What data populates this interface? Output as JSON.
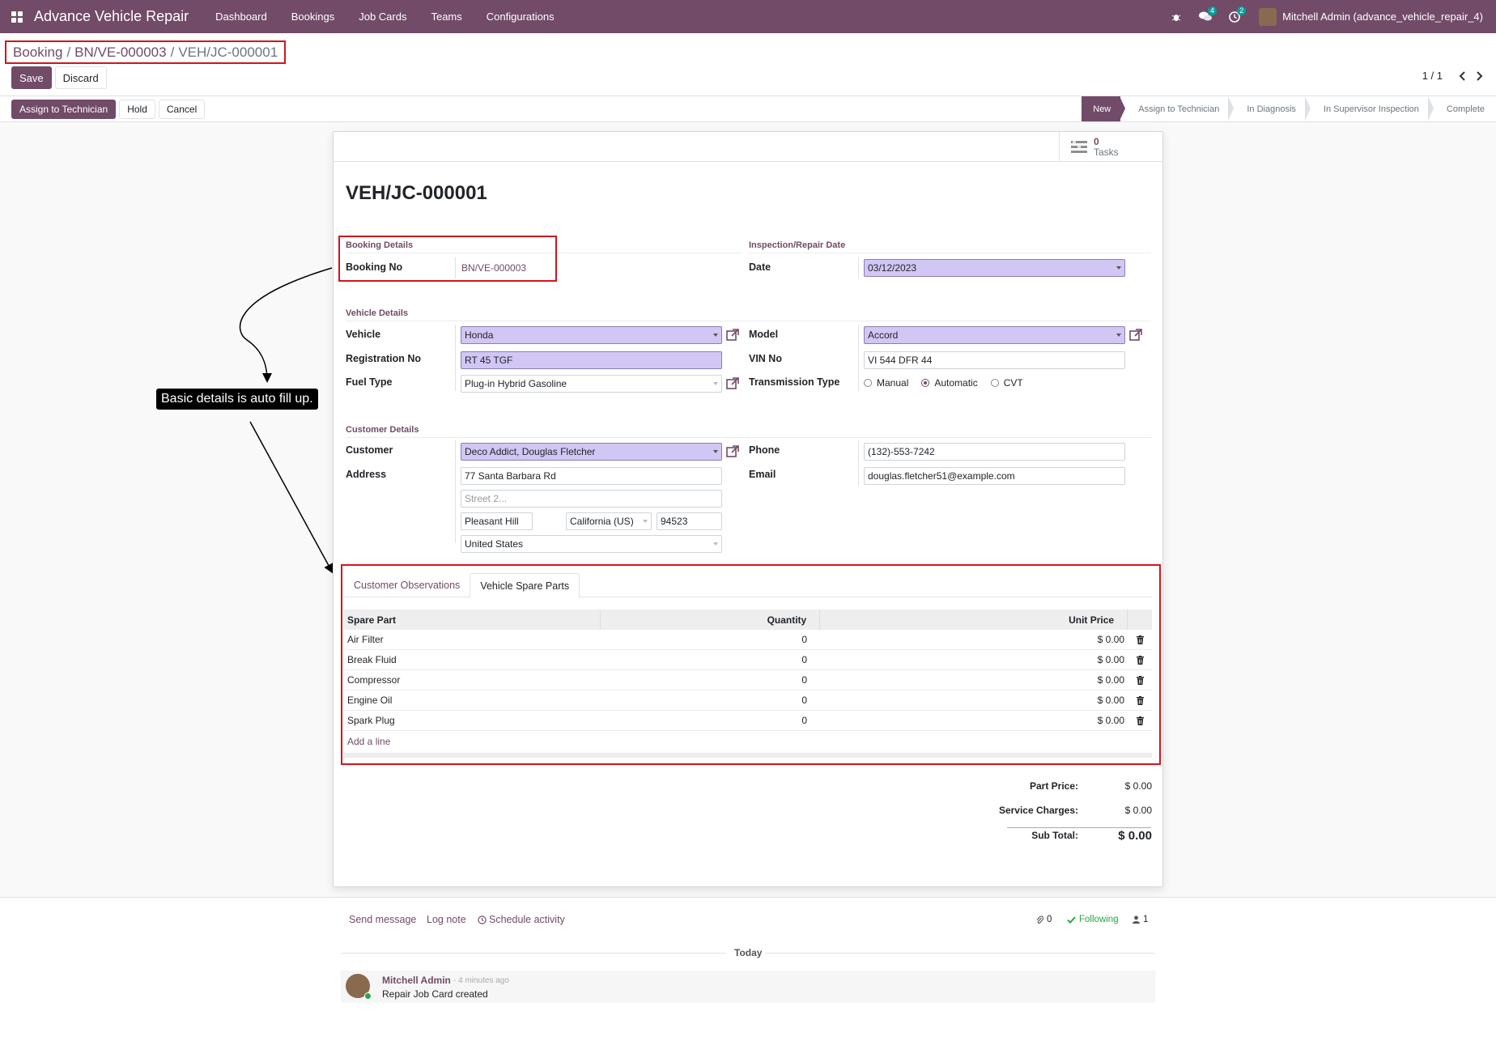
{
  "app": {
    "title": "Advance Vehicle Repair",
    "menu": [
      "Dashboard",
      "Bookings",
      "Job Cards",
      "Teams",
      "Configurations"
    ],
    "messages_badge": "4",
    "activities_badge": "2",
    "user": "Mitchell Admin (advance_vehicle_repair_4)"
  },
  "breadcrumb": {
    "root": "Booking",
    "sep1": "/",
    "parent": "BN/VE-000003",
    "sep2": "/",
    "current": "VEH/JC-000001"
  },
  "actions": {
    "save": "Save",
    "discard": "Discard"
  },
  "pager": {
    "value": "1 / 1"
  },
  "status_buttons": {
    "assign": "Assign to Technician",
    "hold": "Hold",
    "cancel": "Cancel"
  },
  "stages": [
    "New",
    "Assign to Technician",
    "In Diagnosis",
    "In Supervisor Inspection",
    "Complete"
  ],
  "smart_button": {
    "count": "0",
    "label": "Tasks"
  },
  "form": {
    "title": "VEH/JC-000001",
    "booking_section": "Booking Details",
    "booking_no_label": "Booking No",
    "booking_no": "BN/VE-000003",
    "inspection_section": "Inspection/Repair Date",
    "date_label": "Date",
    "date": "03/12/2023",
    "vehicle_section": "Vehicle Details",
    "vehicle_label": "Vehicle",
    "vehicle": "Honda",
    "model_label": "Model",
    "model": "Accord",
    "reg_label": "Registration No",
    "reg": "RT 45 TGF",
    "vin_label": "VIN No",
    "vin": "VI 544 DFR 44",
    "fuel_label": "Fuel Type",
    "fuel": "Plug-in Hybrid Gasoline",
    "transmission_label": "Transmission Type",
    "transmission_options": [
      "Manual",
      "Automatic",
      "CVT"
    ],
    "customer_section": "Customer Details",
    "customer_label": "Customer",
    "customer": "Deco Addict, Douglas Fletcher",
    "phone_label": "Phone",
    "phone": "(132)-553-7242",
    "address_label": "Address",
    "street": "77 Santa Barbara Rd",
    "street2_placeholder": "Street 2...",
    "city": "Pleasant Hill",
    "state": "California (US)",
    "zip": "94523",
    "country": "United States",
    "email_label": "Email",
    "email": "douglas.fletcher51@example.com"
  },
  "tabs": [
    "Customer Observations",
    "Vehicle Spare Parts"
  ],
  "grid": {
    "headers": [
      "Spare Part",
      "Quantity",
      "Unit Price"
    ],
    "rows": [
      {
        "part": "Air Filter",
        "qty": "0",
        "price": "$ 0.00"
      },
      {
        "part": "Break Fluid",
        "qty": "0",
        "price": "$ 0.00"
      },
      {
        "part": "Compressor",
        "qty": "0",
        "price": "$ 0.00"
      },
      {
        "part": "Engine Oil",
        "qty": "0",
        "price": "$ 0.00"
      },
      {
        "part": "Spark Plug",
        "qty": "0",
        "price": "$ 0.00"
      }
    ],
    "add_line": "Add a line"
  },
  "totals": {
    "part_price_label": "Part Price:",
    "part_price": "$ 0.00",
    "service_label": "Service Charges:",
    "service": "$ 0.00",
    "subtotal_label": "Sub Total:",
    "subtotal": "$ 0.00"
  },
  "annotation": "Basic details is auto fill up.",
  "chatter": {
    "send_message": "Send message",
    "log_note": "Log note",
    "schedule_activity": "Schedule activity",
    "attachments": "0",
    "following": "Following",
    "followers": "1",
    "today": "Today",
    "author": "Mitchell Admin",
    "time": "- 4 minutes ago",
    "body": "Repair Job Card created"
  },
  "colors": {
    "brand": "#714B67",
    "highlight": "#d4141c",
    "required_bg": "#d2c6f5"
  }
}
